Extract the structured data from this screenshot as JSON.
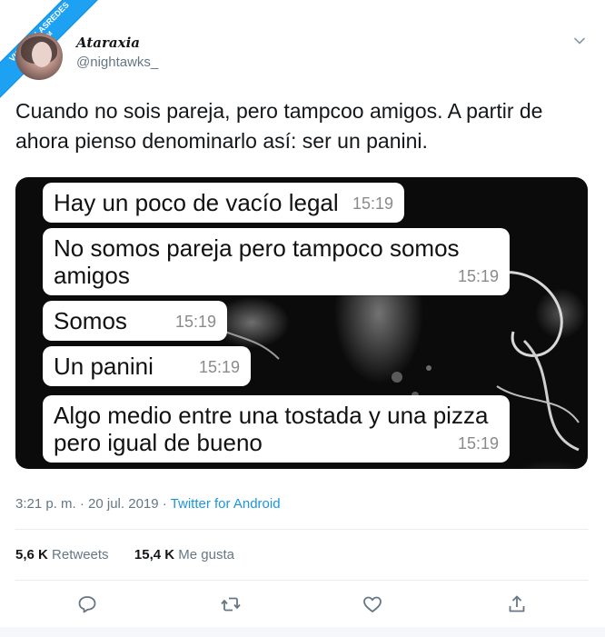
{
  "watermark": {
    "line1": "VISTOENLASREDES",
    "line2": ".COM"
  },
  "user": {
    "display_name": "Ataraxia",
    "handle": "@nightawks_"
  },
  "tweet": {
    "text": "Cuando no sois pareja, pero tampcoo amigos. A partir de ahora pienso denominarlo así: ser un panini."
  },
  "chat": {
    "messages": [
      {
        "text": "Hay un poco de vacío legal",
        "time": "15:19"
      },
      {
        "text": "No somos pareja pero tampoco somos amigos",
        "time": "15:19"
      },
      {
        "text": "Somos",
        "time": "15:19"
      },
      {
        "text": "Un panini",
        "time": "15:19"
      },
      {
        "text": "Algo medio entre una tostada y una pizza pero igual de bueno",
        "time": "15:19"
      }
    ]
  },
  "meta": {
    "datetime": "3:21 p. m. · 20 jul. 2019 · ",
    "source": "Twitter for Android"
  },
  "stats": {
    "retweets_count": "5,6 K",
    "retweets_label": "Retweets",
    "likes_count": "15,4 K",
    "likes_label": "Me gusta"
  },
  "icons": {
    "menu": "chevron-down-icon",
    "reply": "reply-icon",
    "retweet": "retweet-icon",
    "like": "heart-icon",
    "share": "share-icon"
  },
  "colors": {
    "link": "#1b95e0",
    "secondary_text": "#657786",
    "watermark": "#1da1f2"
  }
}
